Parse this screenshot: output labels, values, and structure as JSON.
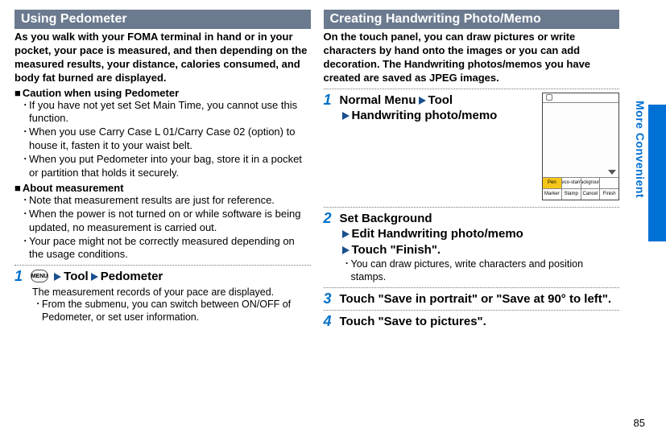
{
  "left": {
    "header": "Using Pedometer",
    "intro": "As you walk with your FOMA terminal in hand or in your pocket, your pace is measured, and then depending on the measured results, your distance, calories consumed, and body fat burned are displayed.",
    "caution_heading": "Caution when using Pedometer",
    "caution_items": [
      "If you have not yet set Set Main Time, you cannot use this function.",
      "When you use Carry Case L 01/Carry Case 02 (option) to house it, fasten it to your waist belt.",
      "When you put Pedometer into your bag, store it in a pocket or partition that holds it securely."
    ],
    "about_heading": "About measurement",
    "about_items": [
      "Note that measurement results are just for reference.",
      "When the power is not turned on or while software is being updated, no measurement is carried out.",
      "Your pace might not be correctly measured depending on the usage conditions."
    ],
    "step1": {
      "num": "1",
      "tool": "Tool",
      "pedometer": "Pedometer",
      "menu_label": "MENU",
      "desc": "The measurement records of your pace are displayed.",
      "sub": "From the submenu, you can switch between ON/OFF of Pedometer, or set user information."
    }
  },
  "right": {
    "header": "Creating Handwriting Photo/Memo",
    "intro": "On the touch panel, you can draw pictures or write characters by hand onto the images or you can add decoration. The Handwriting photos/memos you have created are saved as JPEG images.",
    "step1": {
      "num": "1",
      "line1a": "Normal Menu",
      "line1b": "Tool",
      "line2": "Handwriting photo/memo"
    },
    "step2": {
      "num": "2",
      "line1": "Set Background",
      "line2": "Edit Handwriting photo/memo",
      "line3": "Touch \"Finish\".",
      "sub": "You can draw pictures, write characters and position stamps."
    },
    "step3": {
      "num": "3",
      "line": "Touch \"Save in portrait\" or \"Save at 90° to left\"."
    },
    "step4": {
      "num": "4",
      "line": "Touch \"Save to pictures\"."
    },
    "thumb": {
      "row1": [
        "Pen",
        "Deco-stamp",
        "Background",
        ""
      ],
      "row2": [
        "Marker",
        "Stamp",
        "Cancel",
        "Finish"
      ]
    }
  },
  "side_label": "More Convenient",
  "page": "85"
}
